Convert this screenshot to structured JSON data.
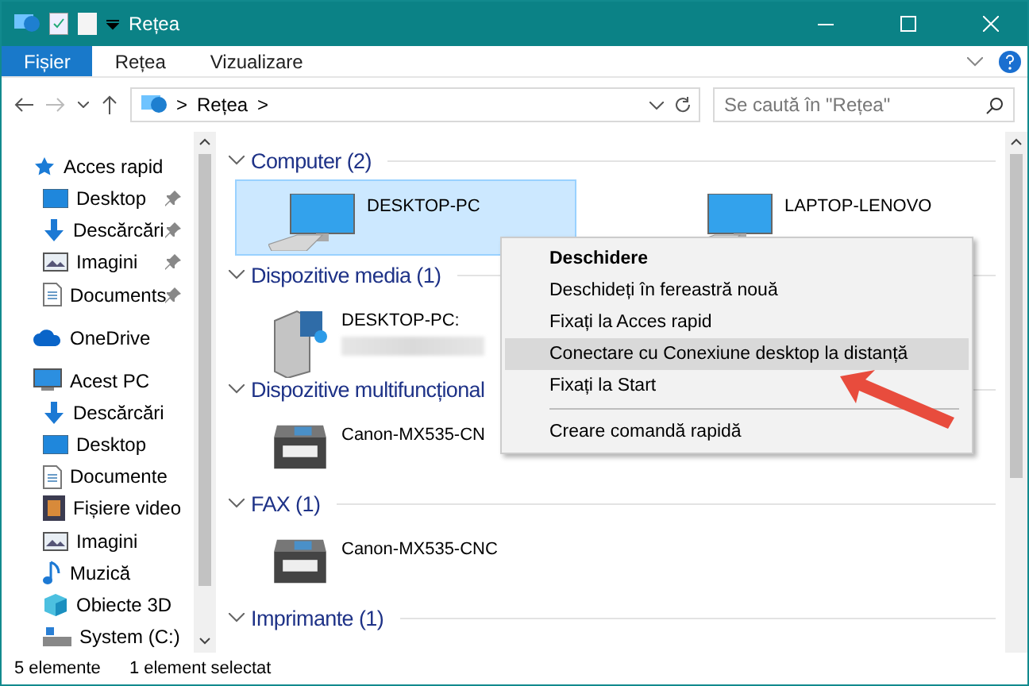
{
  "window": {
    "title": "Rețea"
  },
  "ribbon_tabs": [
    {
      "label": "Fișier",
      "selected": true
    },
    {
      "label": "Rețea",
      "selected": false
    },
    {
      "label": "Vizualizare",
      "selected": false
    }
  ],
  "address_bar": {
    "path": "Rețea",
    "separator": ">"
  },
  "search": {
    "placeholder": "Se caută în \"Rețea\""
  },
  "sidebar": {
    "items": [
      {
        "label": "Acces rapid",
        "kind": "star",
        "pinned": false,
        "indent": false
      },
      {
        "label": "Desktop",
        "kind": "desktop",
        "pinned": true,
        "indent": true
      },
      {
        "label": "Descărcări",
        "kind": "download",
        "pinned": true,
        "indent": true
      },
      {
        "label": "Imagini",
        "kind": "pictures",
        "pinned": true,
        "indent": true
      },
      {
        "label": "Documents",
        "kind": "document",
        "pinned": true,
        "indent": true
      },
      {
        "label": "OneDrive",
        "kind": "cloud",
        "pinned": false,
        "indent": false
      },
      {
        "label": "Acest PC",
        "kind": "pc",
        "pinned": false,
        "indent": false
      },
      {
        "label": "Descărcări",
        "kind": "download",
        "pinned": false,
        "indent": true
      },
      {
        "label": "Desktop",
        "kind": "desktop",
        "pinned": false,
        "indent": true
      },
      {
        "label": "Documente",
        "kind": "document",
        "pinned": false,
        "indent": true
      },
      {
        "label": "Fișiere video",
        "kind": "video",
        "pinned": false,
        "indent": true
      },
      {
        "label": "Imagini",
        "kind": "pictures",
        "pinned": false,
        "indent": true
      },
      {
        "label": "Muzică",
        "kind": "music",
        "pinned": false,
        "indent": true
      },
      {
        "label": "Obiecte 3D",
        "kind": "cube",
        "pinned": false,
        "indent": true
      },
      {
        "label": "System (C:)",
        "kind": "drive",
        "pinned": false,
        "indent": true
      }
    ]
  },
  "groups": [
    {
      "title": "Computer (2)",
      "items": [
        {
          "name": "DESKTOP-PC",
          "kind": "computer",
          "selected": true,
          "redacted": false
        },
        {
          "name": "LAPTOP-LENOVO",
          "kind": "computer",
          "selected": false,
          "redacted": false
        }
      ]
    },
    {
      "title": "Dispozitive media (1)",
      "items": [
        {
          "name": "DESKTOP-PC:",
          "kind": "media",
          "selected": false,
          "redacted": true
        }
      ]
    },
    {
      "title": "Dispozitive multifuncțional",
      "items": [
        {
          "name": "Canon-MX535-CN",
          "kind": "printer",
          "selected": false,
          "redacted": false
        }
      ]
    },
    {
      "title": "FAX (1)",
      "items": [
        {
          "name": "Canon-MX535-CNC",
          "kind": "printer",
          "selected": false,
          "redacted": false
        }
      ]
    },
    {
      "title": "Imprimante (1)"
    }
  ],
  "context_menu": {
    "items": [
      {
        "label": "Deschidere",
        "default": true,
        "selected": false,
        "separator_before": false
      },
      {
        "label": "Deschideți în fereastră nouă",
        "default": false,
        "selected": false,
        "separator_before": false
      },
      {
        "label": "Fixați la Acces rapid",
        "default": false,
        "selected": false,
        "separator_before": false
      },
      {
        "label": "Conectare cu Conexiune desktop la distanță",
        "default": false,
        "selected": true,
        "separator_before": false
      },
      {
        "label": "Fixați la Start",
        "default": false,
        "selected": false,
        "separator_before": false
      },
      {
        "label": "Creare comandă rapidă",
        "default": false,
        "selected": false,
        "separator_before": true
      }
    ]
  },
  "status_bar": {
    "count": "5 elemente",
    "selection": "1 element selectat"
  }
}
